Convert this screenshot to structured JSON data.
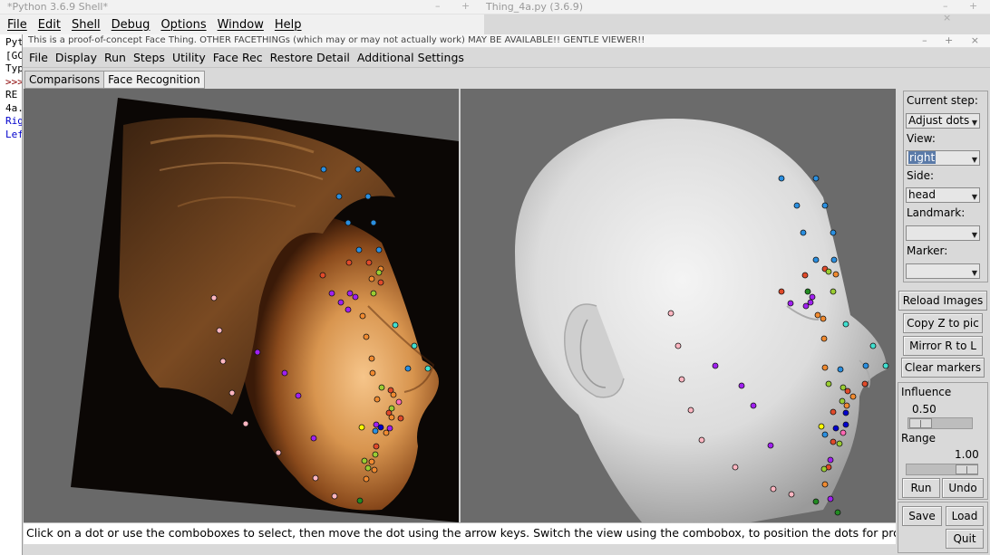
{
  "shell": {
    "title": "*Python 3.6.9 Shell*",
    "menu": [
      "File",
      "Edit",
      "Shell",
      "Debug",
      "Options",
      "Window",
      "Help"
    ],
    "lines": [
      {
        "text": "Pyt",
        "color": "#000"
      },
      {
        "text": "[GC",
        "color": "#000"
      },
      {
        "text": "Typ",
        "color": "#000"
      },
      {
        "text": ">>>",
        "color": "#8b0000"
      },
      {
        "text": " RE",
        "color": "#000"
      },
      {
        "text": "4a.",
        "color": "#000"
      },
      {
        "text": "Rig",
        "color": "#0000cc"
      },
      {
        "text": "Lef",
        "color": "#0000cc"
      }
    ]
  },
  "editor": {
    "title": "Thing_4a.py (3.6.9)"
  },
  "window_controls": "– + ×",
  "app": {
    "title": "This is a proof-of-concept Face Thing.  OTHER FACETHINGs (which may or may not actually work) MAY BE AVAILABLE!! GENTLE VIEWER!!",
    "menu": [
      "File",
      "Display",
      "Run",
      "Steps",
      "Utility",
      "Face Rec",
      "Restore Detail",
      "Additional Settings"
    ],
    "tabs": [
      {
        "label": "Comparisons",
        "active": false
      },
      {
        "label": "Face Recognition",
        "active": true
      }
    ],
    "status": "Click on a dot or use the comboboxes to select, then move the dot using the arrow keys. Switch the view using the combobox, to position the dots for profile view from left and right."
  },
  "controls": {
    "current_step_label": "Current step:",
    "current_step_value": "Adjust dots",
    "view_label": "View:",
    "view_value": "right",
    "side_label": "Side:",
    "side_value": "head",
    "landmark_label": "Landmark:",
    "landmark_value": "",
    "marker_label": "Marker:",
    "marker_value": "",
    "reload_images": "Reload Images",
    "copy_z": "Copy Z to pic",
    "mirror": "Mirror R to L",
    "clear_markers": "Clear markers",
    "influence_label": "Influence",
    "influence_value": "0.50",
    "range_label": "Range",
    "range_value": "1.00",
    "run": "Run",
    "undo": "Undo",
    "save": "Save",
    "load": "Load",
    "quit": "Quit"
  },
  "dot_colors": [
    "#2a8fe0",
    "#e04a2a",
    "#f08a30",
    "#9acd32",
    "#a020f0",
    "#ffb6c1",
    "#40e0d0",
    "#ffff00",
    "#0000cd",
    "#228b22",
    "#ff69b4"
  ]
}
